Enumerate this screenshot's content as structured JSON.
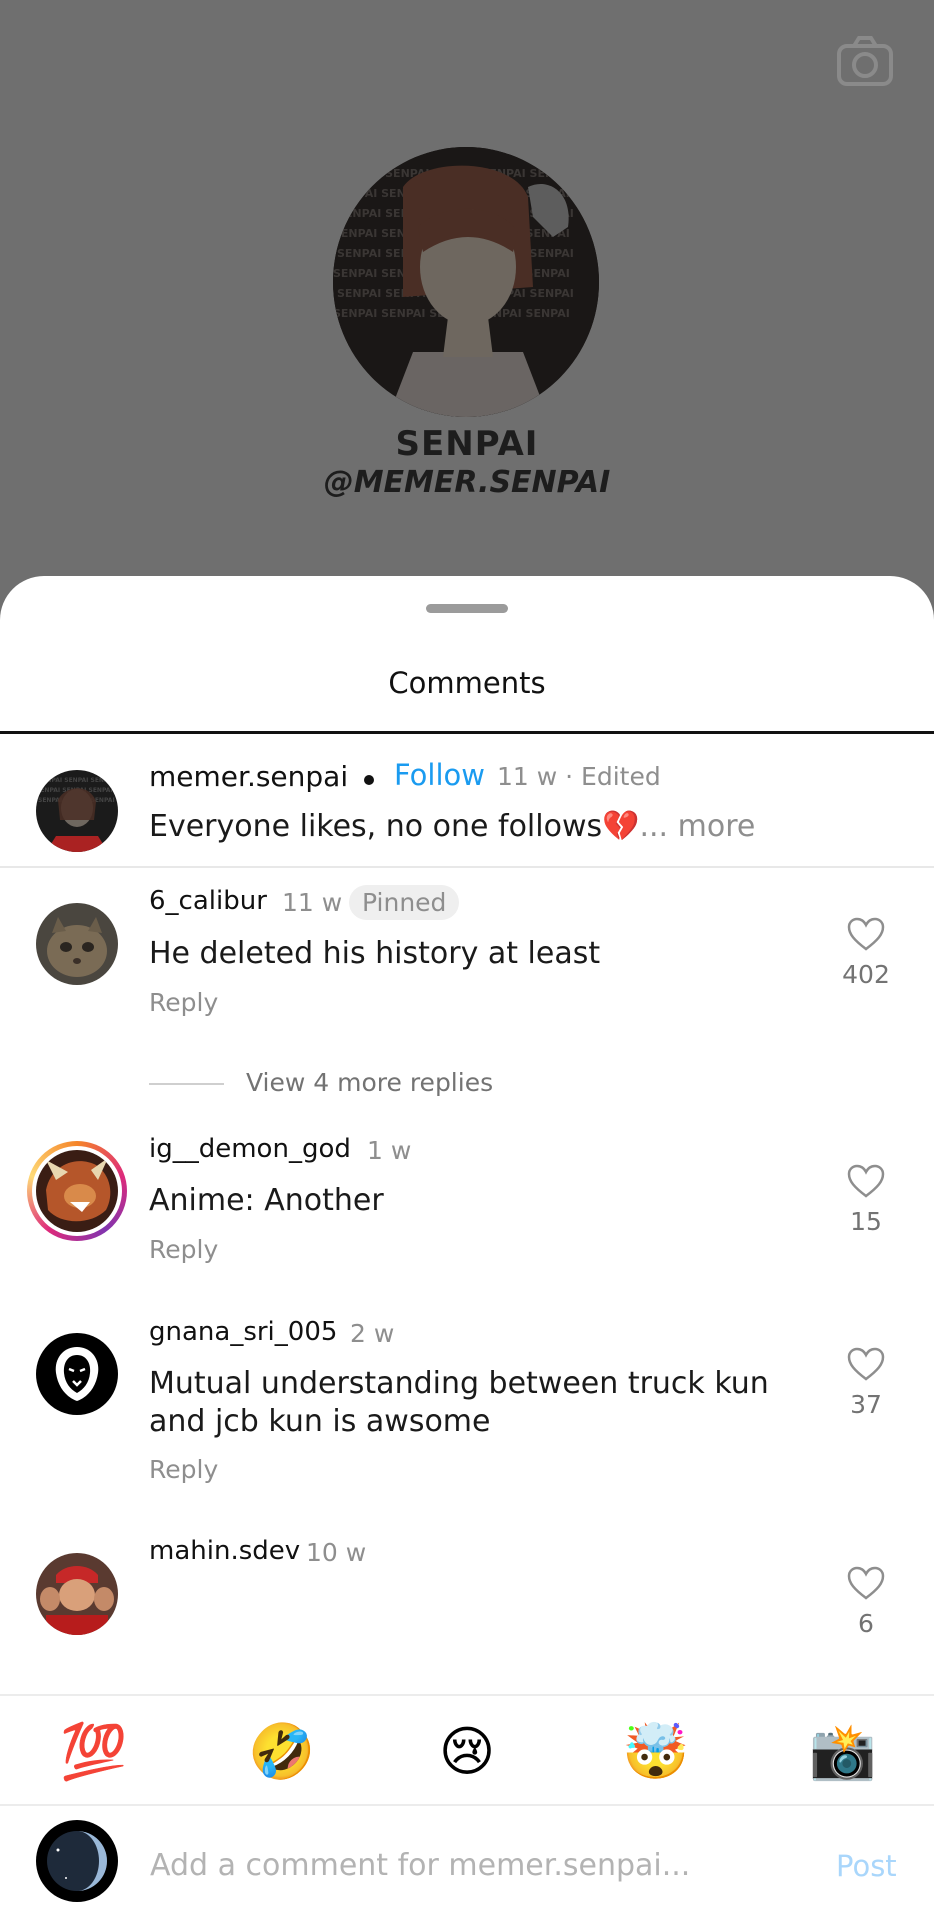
{
  "profile": {
    "name": "SENPAI",
    "handle": "@MEMER.SENPAI"
  },
  "sheet": {
    "title": "Comments"
  },
  "caption": {
    "username": "memer.senpai",
    "follow_label": "Follow",
    "meta": "11 w · Edited",
    "text": "Everyone likes, no one follows💔",
    "more_label": "... more"
  },
  "comments": [
    {
      "username": "6_calibur",
      "time": "11 w",
      "badge": "Pinned",
      "text": "He deleted his history at least",
      "reply_label": "Reply",
      "likes": "402"
    },
    {
      "username": "ig__demon_god",
      "time": "1 w",
      "text": "Anime: Another",
      "reply_label": "Reply",
      "likes": "15"
    },
    {
      "username": "gnana_sri_005",
      "time": "2 w",
      "text": "Mutual understanding between truck kun and jcb kun is awsome",
      "reply_label": "Reply",
      "likes": "37"
    },
    {
      "username": "mahin.sdev",
      "time": "10 w",
      "text": "",
      "likes": "6"
    }
  ],
  "view_more_replies": "View 4 more replies",
  "emoji_bar": [
    "💯",
    "🤣",
    "😢",
    "🤯",
    "📸"
  ],
  "composer": {
    "placeholder": "Add a comment for memer.senpai...",
    "post_label": "Post"
  },
  "colors": {
    "accent": "#1a9bf0",
    "post_disabled": "#a9d6fb",
    "secondary_text": "#8e8e8e"
  },
  "icons": {
    "camera": "camera-icon",
    "heart": "heart-icon"
  }
}
